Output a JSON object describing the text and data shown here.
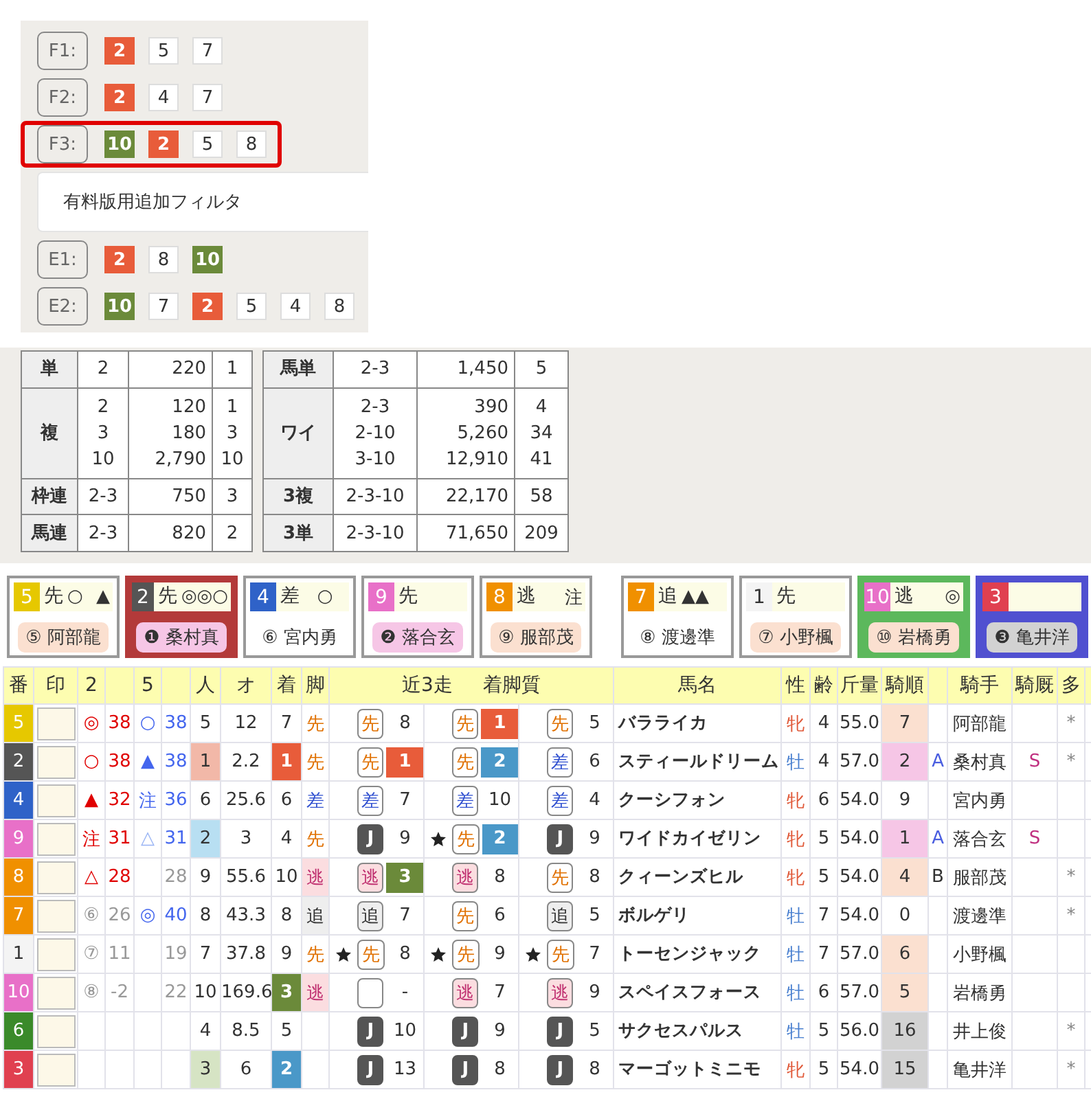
{
  "filters": [
    {
      "label": "F1:",
      "selected": false,
      "chips": [
        {
          "text": "2",
          "kind": "first"
        },
        {
          "text": "5",
          "kind": "plain"
        },
        {
          "text": "7",
          "kind": "plain"
        }
      ]
    },
    {
      "label": "F2:",
      "selected": false,
      "chips": [
        {
          "text": "2",
          "kind": "first"
        },
        {
          "text": "4",
          "kind": "plain"
        },
        {
          "text": "7",
          "kind": "plain"
        }
      ]
    },
    {
      "label": "F3:",
      "selected": true,
      "chips": [
        {
          "text": "10",
          "kind": "third"
        },
        {
          "text": "2",
          "kind": "first"
        },
        {
          "text": "5",
          "kind": "plain"
        },
        {
          "text": "8",
          "kind": "plain"
        }
      ]
    }
  ],
  "filter_note": "有料版用追加フィルタ",
  "extra_filters": [
    {
      "label": "E1:",
      "selected": false,
      "chips": [
        {
          "text": "2",
          "kind": "first"
        },
        {
          "text": "8",
          "kind": "plain"
        },
        {
          "text": "10",
          "kind": "third"
        }
      ]
    },
    {
      "label": "E2:",
      "selected": false,
      "chips": [
        {
          "text": "10",
          "kind": "third"
        },
        {
          "text": "7",
          "kind": "plain"
        },
        {
          "text": "2",
          "kind": "first"
        },
        {
          "text": "5",
          "kind": "plain"
        },
        {
          "text": "4",
          "kind": "plain"
        },
        {
          "text": "8",
          "kind": "plain"
        }
      ]
    }
  ],
  "payouts": [
    {
      "rows": [
        {
          "type": "単",
          "entries": [
            {
              "combo": "2",
              "amount": "220",
              "popularity": "1"
            }
          ]
        },
        {
          "type": "複",
          "entries": [
            {
              "combo": "2",
              "amount": "120",
              "popularity": "1"
            },
            {
              "combo": "3",
              "amount": "180",
              "popularity": "3"
            },
            {
              "combo": "10",
              "amount": "2,790",
              "popularity": "10"
            }
          ]
        },
        {
          "type": "枠連",
          "entries": [
            {
              "combo": "2-3",
              "amount": "750",
              "popularity": "3"
            }
          ]
        },
        {
          "type": "馬連",
          "entries": [
            {
              "combo": "2-3",
              "amount": "820",
              "popularity": "2"
            }
          ]
        }
      ]
    },
    {
      "rows": [
        {
          "type": "馬単",
          "entries": [
            {
              "combo": "2-3",
              "amount": "1,450",
              "popularity": "5"
            }
          ]
        },
        {
          "type": "ワイ",
          "entries": [
            {
              "combo": "2-3",
              "amount": "390",
              "popularity": "4"
            },
            {
              "combo": "2-10",
              "amount": "5,260",
              "popularity": "34"
            },
            {
              "combo": "3-10",
              "amount": "12,910",
              "popularity": "41"
            }
          ]
        },
        {
          "type": "3複",
          "entries": [
            {
              "combo": "2-3-10",
              "amount": "22,170",
              "popularity": "58"
            }
          ]
        },
        {
          "type": "3単",
          "entries": [
            {
              "combo": "2-3-10",
              "amount": "71,650",
              "popularity": "209"
            }
          ]
        }
      ]
    }
  ],
  "horse_cards": [
    {
      "cards": [
        {
          "number": "5",
          "color": "#e6c800",
          "kind": "plain",
          "style": "先",
          "marks": [
            {
              "text": "○",
              "kind": "left"
            },
            {
              "text": "▲",
              "kind": "right"
            }
          ],
          "jockey": {
            "text": "⑤ 阿部龍",
            "kind": "mid"
          }
        },
        {
          "number": "2",
          "color": "#555555",
          "kind": "first",
          "style": "先",
          "marks": [
            {
              "text": "◎◎○",
              "kind": "left"
            }
          ],
          "jockey": {
            "text": "❶ 桑村真",
            "kind": "top"
          }
        },
        {
          "number": "4",
          "color": "#2f62c8",
          "kind": "plain",
          "style": "差",
          "marks": [
            {
              "text": "○",
              "kind": "mid"
            }
          ],
          "jockey": {
            "text": "⑥ 宮内勇",
            "kind": "none"
          }
        },
        {
          "number": "9",
          "color": "#e870c8",
          "kind": "plain",
          "style": "先",
          "jockey": {
            "text": "❷ 落合玄",
            "kind": "top"
          }
        },
        {
          "number": "8",
          "color": "#f09000",
          "kind": "plain",
          "style": "逃",
          "marks": [
            {
              "text": "注",
              "kind": "right"
            }
          ],
          "jockey": {
            "text": "⑨ 服部茂",
            "kind": "mid"
          }
        }
      ]
    },
    {
      "cards": [
        {
          "number": "7",
          "color": "#f09000",
          "kind": "plain",
          "style": "追",
          "marks": [
            {
              "text": "▲▲",
              "kind": "left"
            }
          ],
          "jockey": {
            "text": "⑧ 渡邊準",
            "kind": "none"
          }
        },
        {
          "number": "1",
          "color": "#f4f4f4",
          "kind": "plain",
          "style": "先",
          "jockey": {
            "text": "⑦ 小野楓",
            "kind": "mid"
          }
        },
        {
          "number": "10",
          "color": "#e870c8",
          "kind": "third",
          "style": "逃",
          "marks": [
            {
              "text": "◎",
              "kind": "right"
            }
          ],
          "jockey": {
            "text": "⑩ 岩橋勇",
            "kind": "mid"
          }
        },
        {
          "number": "3",
          "color": "#e04050",
          "kind": "second",
          "jockey": {
            "text": "❸ 亀井洋",
            "kind": "low"
          }
        }
      ]
    }
  ],
  "table": {
    "columns": [
      {
        "label": "番"
      },
      {
        "label": "印"
      },
      {
        "label": "2"
      },
      {},
      {
        "label": "5"
      },
      {},
      {
        "label": "人"
      },
      {
        "label": "オ"
      },
      {
        "label": "着"
      },
      {
        "label": "脚"
      },
      {
        "labels": [
          "近3走",
          "着脚質"
        ]
      },
      {
        "label": "馬名"
      },
      {
        "label": "性"
      },
      {
        "label": "齢"
      },
      {
        "label": "斤量"
      },
      {
        "label": "騎順"
      },
      {},
      {
        "label": "騎手"
      },
      {
        "label": "騎厩"
      },
      {
        "label": "多"
      },
      {}
    ],
    "rows": [
      {
        "number": "5",
        "color": "#e6c800",
        "pred2": {
          "mark": "◎",
          "score": "38",
          "kind": "mark"
        },
        "pred5": {
          "mark": "○",
          "score": "38"
        },
        "popularity": {
          "text": "5",
          "kind": "plain"
        },
        "odds": "12",
        "finish": {
          "text": "7",
          "kind": "plain"
        },
        "style": {
          "text": "先",
          "kind": "senko"
        },
        "races": [
          {
            "star": false,
            "style": {
              "text": "先",
              "kind": "senko"
            },
            "result": {
              "text": "8",
              "kind": "plain"
            }
          },
          {
            "star": false,
            "style": {
              "text": "先",
              "kind": "senko"
            },
            "result": {
              "text": "1",
              "kind": "first"
            }
          },
          {
            "star": false,
            "style": {
              "text": "先",
              "kind": "senko"
            },
            "result": {
              "text": "5",
              "kind": "plain"
            }
          }
        ],
        "name": "バラライカ",
        "sex": {
          "text": "牝",
          "kind": "female"
        },
        "age": "4",
        "weight": "55.0",
        "jockey_rank": {
          "text": "7",
          "kind": "mid"
        },
        "jockey": "阿部龍",
        "multi": "*"
      },
      {
        "number": "2",
        "color": "#555555",
        "pred2": {
          "mark": "○",
          "score": "38",
          "kind": "mark"
        },
        "pred5": {
          "mark": "▲",
          "score": "38"
        },
        "popularity": {
          "text": "1",
          "kind": "first"
        },
        "odds": "2.2",
        "finish": {
          "text": "1",
          "kind": "first"
        },
        "style": {
          "text": "先",
          "kind": "senko"
        },
        "races": [
          {
            "star": false,
            "style": {
              "text": "先",
              "kind": "senko"
            },
            "result": {
              "text": "1",
              "kind": "first"
            }
          },
          {
            "star": false,
            "style": {
              "text": "先",
              "kind": "senko"
            },
            "result": {
              "text": "2",
              "kind": "second"
            }
          },
          {
            "star": false,
            "style": {
              "text": "差",
              "kind": "sashi"
            },
            "result": {
              "text": "6",
              "kind": "plain"
            }
          }
        ],
        "name": "スティールドリーム",
        "sex": {
          "text": "牡",
          "kind": "male"
        },
        "age": "4",
        "weight": "57.0",
        "jockey_rank": {
          "text": "2",
          "kind": "top"
        },
        "grade": {
          "text": "A",
          "color": "#4a5ee0"
        },
        "jockey": "桑村真",
        "stable": "S",
        "multi": "*"
      },
      {
        "number": "4",
        "color": "#2f62c8",
        "pred2": {
          "mark": "▲",
          "score": "32",
          "kind": "mark"
        },
        "pred5": {
          "mark": "注",
          "score": "36"
        },
        "popularity": {
          "text": "6",
          "kind": "plain"
        },
        "odds": "25.6",
        "finish": {
          "text": "6",
          "kind": "plain"
        },
        "style": {
          "text": "差",
          "kind": "sashi"
        },
        "races": [
          {
            "star": false,
            "style": {
              "text": "差",
              "kind": "sashi"
            },
            "result": {
              "text": "7",
              "kind": "plain"
            }
          },
          {
            "star": false,
            "style": {
              "text": "差",
              "kind": "sashi"
            },
            "result": {
              "text": "10",
              "kind": "plain"
            }
          },
          {
            "star": false,
            "style": {
              "text": "差",
              "kind": "sashi"
            },
            "result": {
              "text": "4",
              "kind": "plain"
            }
          }
        ],
        "name": "クーシフォン",
        "sex": {
          "text": "牝",
          "kind": "female"
        },
        "age": "6",
        "weight": "54.0",
        "jockey_rank": {
          "text": "9",
          "kind": "none"
        },
        "jockey": "宮内勇"
      },
      {
        "number": "9",
        "color": "#e870c8",
        "pred2": {
          "mark": "注",
          "score": "31",
          "kind": "mark"
        },
        "pred5": {
          "mark": "△",
          "score": "31"
        },
        "popularity": {
          "text": "2",
          "kind": "second"
        },
        "odds": "3",
        "finish": {
          "text": "4",
          "kind": "plain"
        },
        "style": {
          "text": "先",
          "kind": "senko"
        },
        "races": [
          {
            "star": false,
            "style": {
              "text": "J",
              "kind": "jump"
            },
            "result": {
              "text": "9",
              "kind": "plain"
            }
          },
          {
            "star": true,
            "style": {
              "text": "先",
              "kind": "senko"
            },
            "result": {
              "text": "2",
              "kind": "second"
            }
          },
          {
            "star": false,
            "style": {
              "text": "J",
              "kind": "jump"
            },
            "result": {
              "text": "9",
              "kind": "plain"
            }
          }
        ],
        "name": "ワイドカイゼリン",
        "sex": {
          "text": "牝",
          "kind": "female"
        },
        "age": "5",
        "weight": "54.0",
        "jockey_rank": {
          "text": "1",
          "kind": "top"
        },
        "grade": {
          "text": "A",
          "color": "#4a5ee0"
        },
        "jockey": "落合玄",
        "stable": "S"
      },
      {
        "number": "8",
        "color": "#f09000",
        "pred2": {
          "mark": "△",
          "score": "28",
          "kind": "mark"
        },
        "pred5": {
          "score": "28"
        },
        "popularity": {
          "text": "9",
          "kind": "plain"
        },
        "odds": "55.6",
        "finish": {
          "text": "10",
          "kind": "plain"
        },
        "style": {
          "text": "逃",
          "kind": "nige"
        },
        "races": [
          {
            "star": false,
            "style": {
              "text": "逃",
              "kind": "nige"
            },
            "result": {
              "text": "3",
              "kind": "third"
            }
          },
          {
            "star": false,
            "style": {
              "text": "逃",
              "kind": "nige"
            },
            "result": {
              "text": "8",
              "kind": "plain"
            }
          },
          {
            "star": false,
            "style": {
              "text": "先",
              "kind": "senko"
            },
            "result": {
              "text": "8",
              "kind": "plain"
            }
          }
        ],
        "name": "クィーンズヒル",
        "sex": {
          "text": "牝",
          "kind": "female"
        },
        "age": "5",
        "weight": "54.0",
        "jockey_rank": {
          "text": "4",
          "kind": "mid"
        },
        "grade": {
          "text": "B",
          "color": "#333333"
        },
        "jockey": "服部茂",
        "multi": "*"
      },
      {
        "number": "7",
        "color": "#f09000",
        "pred2": {
          "mark": "⑥",
          "score": "26",
          "kind": "rank"
        },
        "pred5": {
          "mark": "◎",
          "score": "40"
        },
        "popularity": {
          "text": "8",
          "kind": "plain"
        },
        "odds": "43.3",
        "finish": {
          "text": "8",
          "kind": "plain"
        },
        "style": {
          "text": "追",
          "kind": "oikomi"
        },
        "races": [
          {
            "star": false,
            "style": {
              "text": "追",
              "kind": "oikomi"
            },
            "result": {
              "text": "7",
              "kind": "plain"
            }
          },
          {
            "star": false,
            "style": {
              "text": "先",
              "kind": "senko"
            },
            "result": {
              "text": "6",
              "kind": "plain"
            }
          },
          {
            "star": false,
            "style": {
              "text": "追",
              "kind": "oikomi"
            },
            "result": {
              "text": "5",
              "kind": "plain"
            }
          }
        ],
        "name": "ボルゲリ",
        "sex": {
          "text": "牡",
          "kind": "male"
        },
        "age": "7",
        "weight": "54.0",
        "jockey_rank": {
          "text": "0",
          "kind": "none"
        },
        "jockey": "渡邊準",
        "multi": "*"
      },
      {
        "number": "1",
        "color": "#f4f4f4",
        "pred2": {
          "mark": "⑦",
          "score": "11",
          "kind": "rank"
        },
        "pred5": {
          "score": "19"
        },
        "popularity": {
          "text": "7",
          "kind": "plain"
        },
        "odds": "37.8",
        "finish": {
          "text": "9",
          "kind": "plain"
        },
        "style": {
          "text": "先",
          "kind": "senko"
        },
        "races": [
          {
            "star": true,
            "style": {
              "text": "先",
              "kind": "senko"
            },
            "result": {
              "text": "8",
              "kind": "plain"
            }
          },
          {
            "star": true,
            "style": {
              "text": "先",
              "kind": "senko"
            },
            "result": {
              "text": "9",
              "kind": "plain"
            }
          },
          {
            "star": true,
            "style": {
              "text": "先",
              "kind": "senko"
            },
            "result": {
              "text": "7",
              "kind": "plain"
            }
          }
        ],
        "name": "トーセンジャック",
        "sex": {
          "text": "牡",
          "kind": "male"
        },
        "age": "7",
        "weight": "57.0",
        "jockey_rank": {
          "text": "6",
          "kind": "mid"
        },
        "jockey": "小野楓"
      },
      {
        "number": "10",
        "color": "#e870c8",
        "pred2": {
          "mark": "⑧",
          "score": "-2",
          "kind": "rank"
        },
        "pred5": {
          "score": "22"
        },
        "popularity": {
          "text": "10",
          "kind": "plain"
        },
        "odds": "169.6",
        "finish": {
          "text": "3",
          "kind": "third"
        },
        "style": {
          "text": "逃",
          "kind": "nige"
        },
        "races": [
          {
            "star": false,
            "style": {
              "kind": "blank"
            },
            "result": {
              "text": "-",
              "kind": "plain"
            }
          },
          {
            "star": false,
            "style": {
              "text": "逃",
              "kind": "nige"
            },
            "result": {
              "text": "7",
              "kind": "plain"
            }
          },
          {
            "star": false,
            "style": {
              "text": "逃",
              "kind": "nige"
            },
            "result": {
              "text": "9",
              "kind": "plain"
            }
          }
        ],
        "name": "スペイスフォース",
        "sex": {
          "text": "牡",
          "kind": "male"
        },
        "age": "6",
        "weight": "57.0",
        "jockey_rank": {
          "text": "5",
          "kind": "mid"
        },
        "jockey": "岩橋勇"
      },
      {
        "number": "6",
        "color": "#3a8a2a",
        "popularity": {
          "text": "4",
          "kind": "plain"
        },
        "odds": "8.5",
        "finish": {
          "text": "5",
          "kind": "plain"
        },
        "races": [
          {
            "star": false,
            "style": {
              "text": "J",
              "kind": "jump"
            },
            "result": {
              "text": "10",
              "kind": "plain"
            }
          },
          {
            "star": false,
            "style": {
              "text": "J",
              "kind": "jump"
            },
            "result": {
              "text": "9",
              "kind": "plain"
            }
          },
          {
            "star": false,
            "style": {
              "text": "J",
              "kind": "jump"
            },
            "result": {
              "text": "5",
              "kind": "plain"
            }
          }
        ],
        "name": "サクセスパルス",
        "sex": {
          "text": "牡",
          "kind": "male"
        },
        "age": "5",
        "weight": "56.0",
        "jockey_rank": {
          "text": "16",
          "kind": "low"
        },
        "jockey": "井上俊",
        "multi": "*"
      },
      {
        "number": "3",
        "color": "#e04050",
        "popularity": {
          "text": "3",
          "kind": "third"
        },
        "odds": "6",
        "finish": {
          "text": "2",
          "kind": "second"
        },
        "races": [
          {
            "star": false,
            "style": {
              "text": "J",
              "kind": "jump"
            },
            "result": {
              "text": "13",
              "kind": "plain"
            }
          },
          {
            "star": false,
            "style": {
              "text": "J",
              "kind": "jump"
            },
            "result": {
              "text": "8",
              "kind": "plain"
            }
          },
          {
            "star": false,
            "style": {
              "text": "J",
              "kind": "jump"
            },
            "result": {
              "text": "8",
              "kind": "plain"
            }
          }
        ],
        "name": "マーゴットミニモ",
        "sex": {
          "text": "牝",
          "kind": "female"
        },
        "age": "5",
        "weight": "54.0",
        "jockey_rank": {
          "text": "15",
          "kind": "low"
        },
        "jockey": "亀井洋",
        "multi": "*"
      }
    ]
  }
}
